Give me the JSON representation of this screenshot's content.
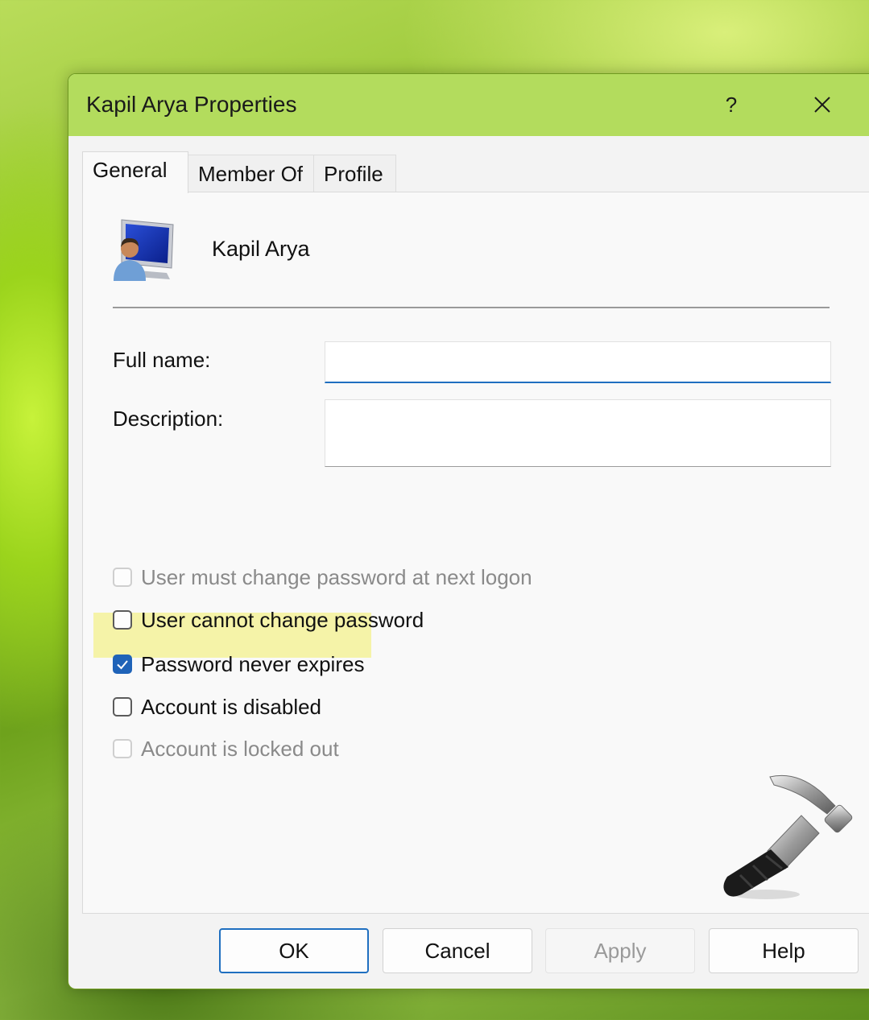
{
  "window": {
    "title": "Kapil Arya Properties",
    "help_label": "?",
    "close_icon": "close-icon"
  },
  "tabs": [
    {
      "label": "General",
      "active": true
    },
    {
      "label": "Member Of",
      "active": false
    },
    {
      "label": "Profile",
      "active": false
    }
  ],
  "general": {
    "user_icon": "user-computer-icon",
    "user_name": "Kapil Arya",
    "full_name_label": "Full name:",
    "full_name_value": "",
    "description_label": "Description:",
    "description_value": "",
    "checkboxes": [
      {
        "label": "User must change password at next logon",
        "checked": false,
        "enabled": false
      },
      {
        "label": "User cannot change password",
        "checked": false,
        "enabled": true
      },
      {
        "label": "Password never expires",
        "checked": true,
        "enabled": true
      },
      {
        "label": "Account is disabled",
        "checked": false,
        "enabled": true,
        "highlighted": true
      },
      {
        "label": "Account is locked out",
        "checked": false,
        "enabled": false
      }
    ],
    "watermark_icon": "hammer-icon"
  },
  "buttons": {
    "ok": "OK",
    "cancel": "Cancel",
    "apply": "Apply",
    "help": "Help"
  },
  "colors": {
    "titlebar": "#b3dc5d",
    "accent": "#1f63b8",
    "highlight": "#f5f3a8"
  }
}
